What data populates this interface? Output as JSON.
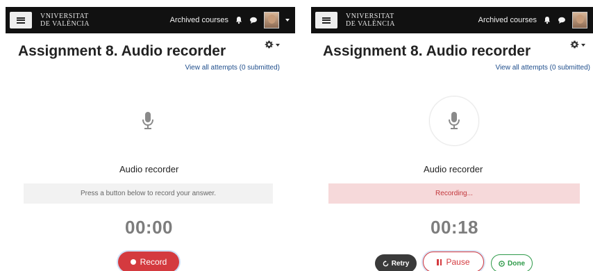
{
  "header": {
    "logo_line1": "VNIVERSITAT",
    "logo_line2": "DE VALÈNCIA",
    "archived_courses": "Archived courses",
    "bell_icon": "bell-icon",
    "chat_icon": "chat-bubble-icon",
    "menu_icon": "hamburger-icon"
  },
  "page": {
    "title": "Assignment 8. Audio recorder",
    "view_attempts": "View all attempts (0 submitted)",
    "recorder_label": "Audio recorder",
    "mic_icon": "microphone-icon",
    "settings_icon": "gear-icon"
  },
  "left_state": {
    "status": "Press a button below to record your answer.",
    "timer": "00:00",
    "record_label": "Record"
  },
  "right_state": {
    "status": "Recording...",
    "timer": "00:18",
    "retry_label": "Retry",
    "pause_label": "Pause",
    "done_label": "Done"
  },
  "colors": {
    "navbar": "#111111",
    "record_red": "#d43a3f",
    "done_green": "#2e9a49",
    "link_blue": "#1f4e8c",
    "recording_bg": "#f6d9da"
  }
}
